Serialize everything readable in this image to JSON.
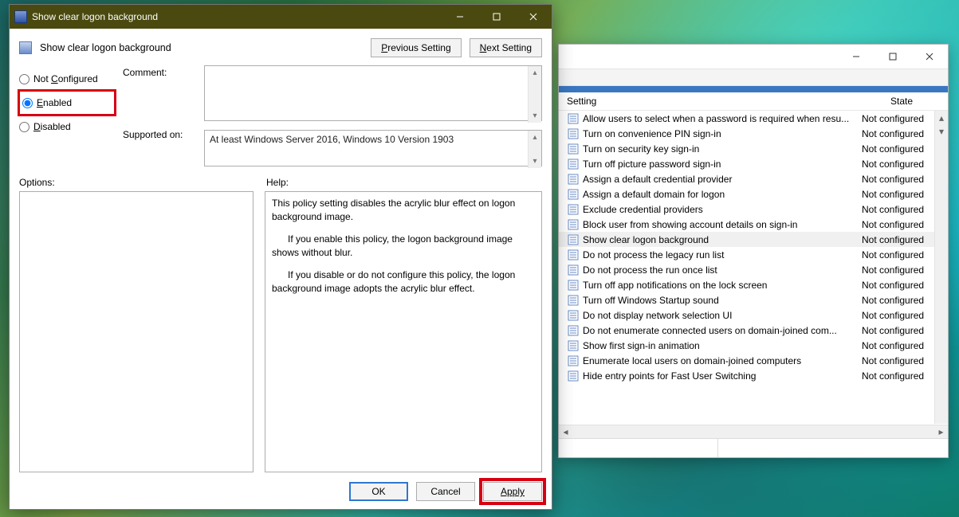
{
  "dialog": {
    "window_title": "Show clear logon background",
    "heading": "Show clear logon background",
    "nav": {
      "prev": "Previous Setting",
      "next": "Next Setting"
    },
    "radios": {
      "not_configured": "Not Configured",
      "enabled": "Enabled",
      "disabled": "Disabled",
      "selected": "enabled"
    },
    "labels": {
      "comment": "Comment:",
      "supported": "Supported on:",
      "options": "Options:",
      "help": "Help:"
    },
    "comment_value": "",
    "supported_value": "At least Windows Server 2016, Windows 10 Version 1903",
    "help_paragraphs": [
      "This policy setting disables the acrylic blur effect on logon background image.",
      "If you enable this policy, the logon background image shows without blur.",
      "If you disable or do not configure this policy, the logon background image adopts the acrylic blur effect."
    ],
    "buttons": {
      "ok": "OK",
      "cancel": "Cancel",
      "apply": "Apply"
    }
  },
  "policy_window": {
    "columns": {
      "setting": "Setting",
      "state": "State"
    },
    "items": [
      {
        "name": "Allow users to select when a password is required when resu...",
        "state": "Not configured"
      },
      {
        "name": "Turn on convenience PIN sign-in",
        "state": "Not configured"
      },
      {
        "name": "Turn on security key sign-in",
        "state": "Not configured"
      },
      {
        "name": "Turn off picture password sign-in",
        "state": "Not configured"
      },
      {
        "name": "Assign a default credential provider",
        "state": "Not configured"
      },
      {
        "name": "Assign a default domain for logon",
        "state": "Not configured"
      },
      {
        "name": "Exclude credential providers",
        "state": "Not configured"
      },
      {
        "name": "Block user from showing account details on sign-in",
        "state": "Not configured"
      },
      {
        "name": "Show clear logon background",
        "state": "Not configured",
        "selected": true
      },
      {
        "name": "Do not process the legacy run list",
        "state": "Not configured"
      },
      {
        "name": "Do not process the run once list",
        "state": "Not configured"
      },
      {
        "name": "Turn off app notifications on the lock screen",
        "state": "Not configured"
      },
      {
        "name": "Turn off Windows Startup sound",
        "state": "Not configured"
      },
      {
        "name": "Do not display network selection UI",
        "state": "Not configured"
      },
      {
        "name": "Do not enumerate connected users on domain-joined com...",
        "state": "Not configured"
      },
      {
        "name": "Show first sign-in animation",
        "state": "Not configured"
      },
      {
        "name": "Enumerate local users on domain-joined computers",
        "state": "Not configured"
      },
      {
        "name": "Hide entry points for Fast User Switching",
        "state": "Not configured"
      }
    ]
  }
}
